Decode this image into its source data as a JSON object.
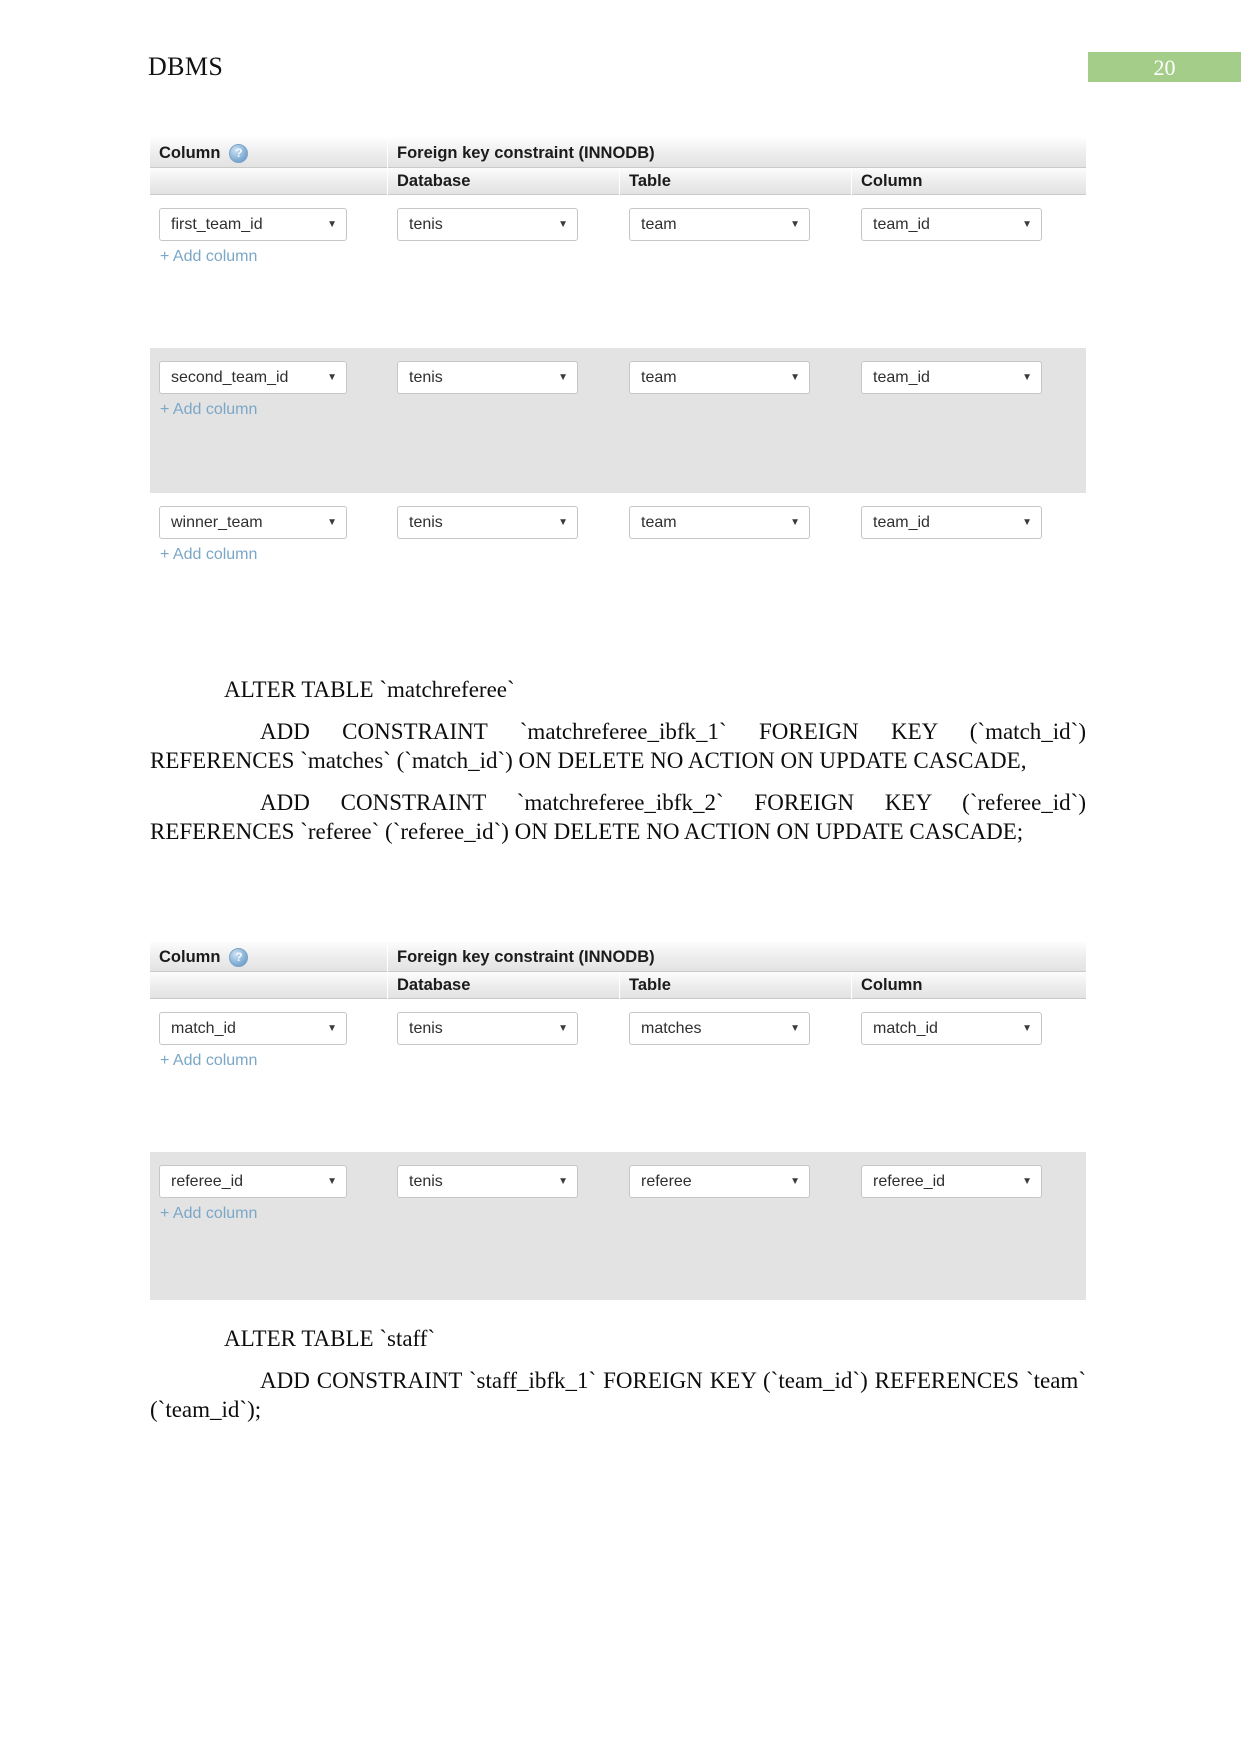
{
  "header": {
    "doc_title": "DBMS",
    "page_number": "20",
    "badge_color": "#a5cd8a"
  },
  "fk_table_1": {
    "headers": {
      "column": "Column",
      "help_icon": "help-circle-icon",
      "foreign_key": "Foreign key constraint (INNODB)",
      "database": "Database",
      "table": "Table",
      "ref_column": "Column"
    },
    "add_column_label": "+ Add column",
    "rows": [
      {
        "column": "first_team_id",
        "database": "tenis",
        "table": "team",
        "ref_column": "team_id",
        "shaded": false
      },
      {
        "column": "second_team_id",
        "database": "tenis",
        "table": "team",
        "ref_column": "team_id",
        "shaded": true
      },
      {
        "column": "winner_team",
        "database": "tenis",
        "table": "team",
        "ref_column": "team_id",
        "shaded": false
      }
    ]
  },
  "sql_block_1": {
    "line1": "ALTER TABLE `matchreferee`",
    "para1": "ADD CONSTRAINT `matchreferee_ibfk_1` FOREIGN KEY (`match_id`) REFERENCES `matches` (`match_id`) ON DELETE NO ACTION ON UPDATE CASCADE,",
    "para2": "ADD CONSTRAINT `matchreferee_ibfk_2` FOREIGN KEY (`referee_id`) REFERENCES `referee` (`referee_id`) ON DELETE NO ACTION ON UPDATE CASCADE;"
  },
  "fk_table_2": {
    "headers": {
      "column": "Column",
      "help_icon": "help-circle-icon",
      "foreign_key": "Foreign key constraint (INNODB)",
      "database": "Database",
      "table": "Table",
      "ref_column": "Column"
    },
    "add_column_label": "+ Add column",
    "rows": [
      {
        "column": "match_id",
        "database": "tenis",
        "table": "matches",
        "ref_column": "match_id",
        "shaded": false
      },
      {
        "column": "referee_id",
        "database": "tenis",
        "table": "referee",
        "ref_column": "referee_id",
        "shaded": true
      }
    ]
  },
  "sql_block_2": {
    "line1": "ALTER TABLE `staff`",
    "para1": "ADD CONSTRAINT `staff_ibfk_1` FOREIGN KEY (`team_id`) REFERENCES `team` (`team_id`);"
  }
}
